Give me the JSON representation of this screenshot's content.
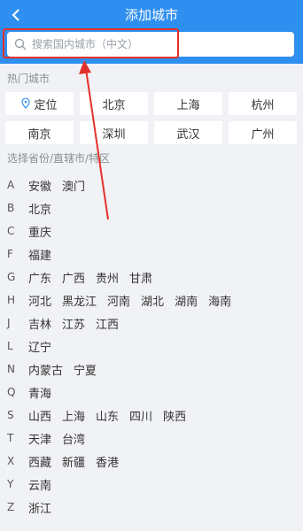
{
  "header": {
    "title": "添加城市",
    "back_icon": "chevron-left-icon"
  },
  "search": {
    "placeholder": "搜索国内城市（中文）",
    "icon": "search-icon"
  },
  "hot_cities": {
    "label": "热门城市",
    "locate_label": "定位",
    "cities": [
      "北京",
      "上海",
      "杭州",
      "南京",
      "深圳",
      "武汉",
      "广州"
    ]
  },
  "provinces": {
    "label": "选择省份/直辖市/特区",
    "groups": [
      {
        "letter": "A",
        "items": [
          "安徽",
          "澳门"
        ]
      },
      {
        "letter": "B",
        "items": [
          "北京"
        ]
      },
      {
        "letter": "C",
        "items": [
          "重庆"
        ]
      },
      {
        "letter": "F",
        "items": [
          "福建"
        ]
      },
      {
        "letter": "G",
        "items": [
          "广东",
          "广西",
          "贵州",
          "甘肃"
        ]
      },
      {
        "letter": "H",
        "items": [
          "河北",
          "黑龙江",
          "河南",
          "湖北",
          "湖南",
          "海南"
        ]
      },
      {
        "letter": "J",
        "items": [
          "吉林",
          "江苏",
          "江西"
        ]
      },
      {
        "letter": "L",
        "items": [
          "辽宁"
        ]
      },
      {
        "letter": "N",
        "items": [
          "内蒙古",
          "宁夏"
        ]
      },
      {
        "letter": "Q",
        "items": [
          "青海"
        ]
      },
      {
        "letter": "S",
        "items": [
          "山西",
          "上海",
          "山东",
          "四川",
          "陕西"
        ]
      },
      {
        "letter": "T",
        "items": [
          "天津",
          "台湾"
        ]
      },
      {
        "letter": "X",
        "items": [
          "西藏",
          "新疆",
          "香港"
        ]
      },
      {
        "letter": "Y",
        "items": [
          "云南"
        ]
      },
      {
        "letter": "Z",
        "items": [
          "浙江"
        ]
      }
    ]
  },
  "colors": {
    "header": "#2f8ff0",
    "annotation": "#e4302a",
    "locate_accent": "#2f8ff0"
  }
}
